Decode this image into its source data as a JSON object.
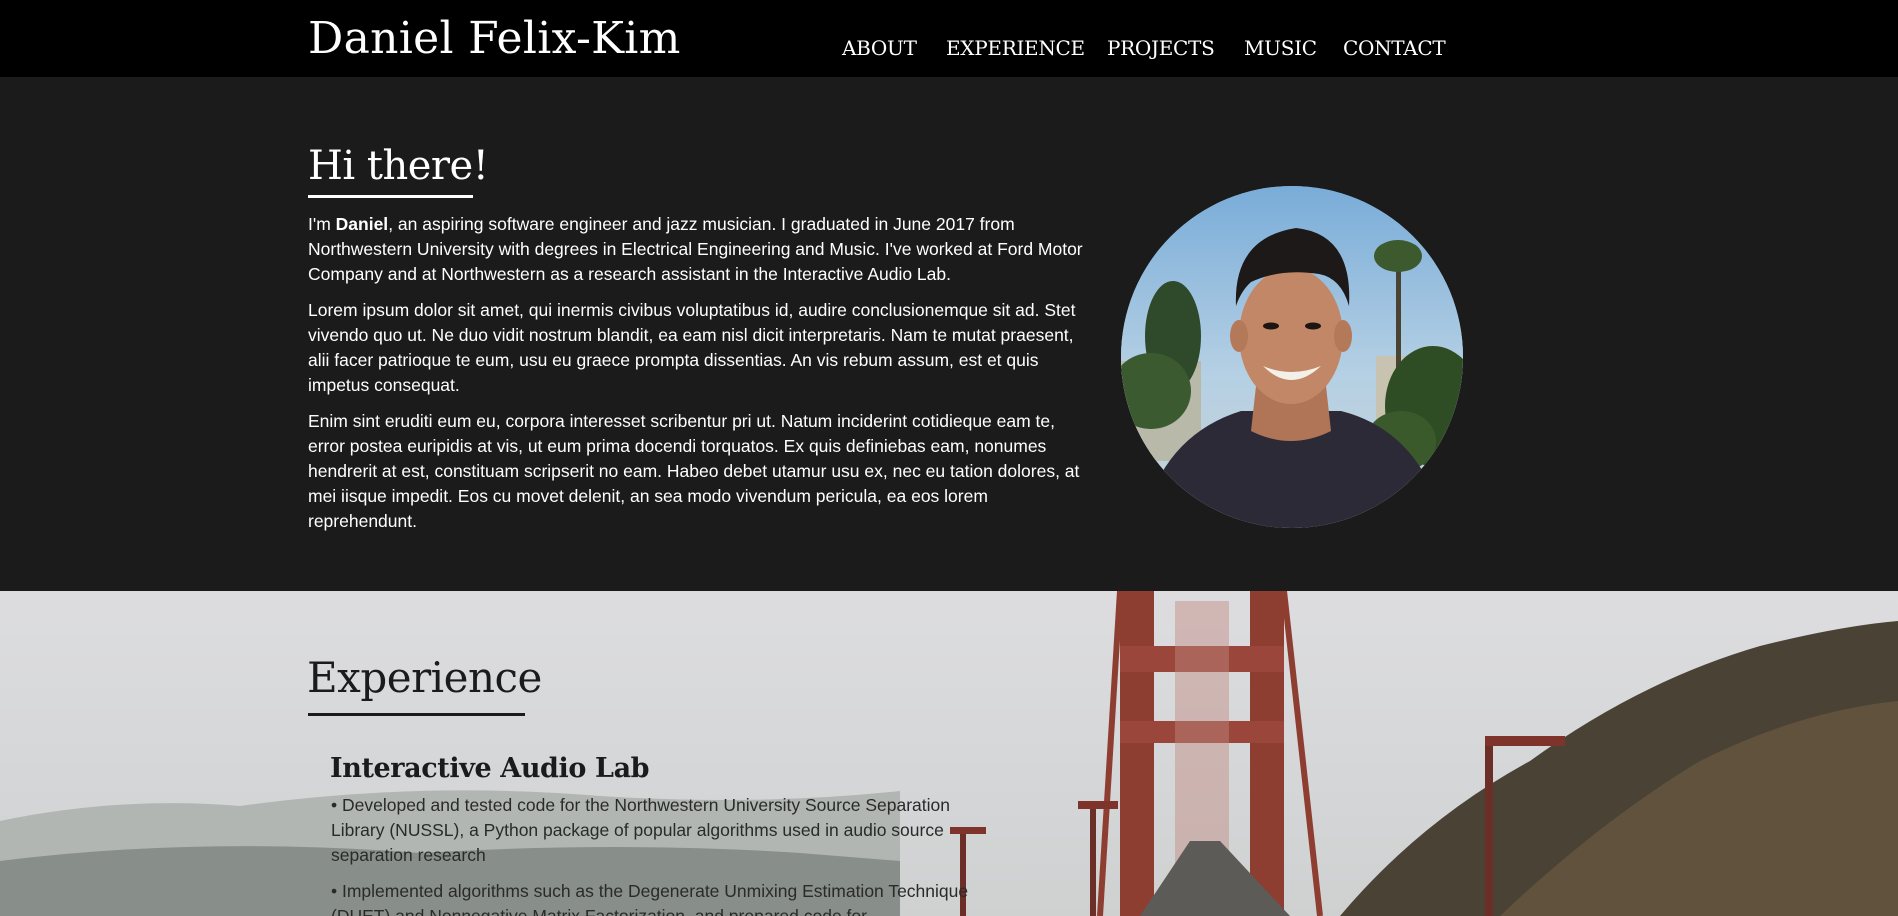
{
  "header": {
    "brand": "Daniel Felix-Kim",
    "nav": {
      "about": "ABOUT",
      "experience": "EXPERIENCE",
      "projects": "PROJECTS",
      "music": "MUSIC",
      "contact": "CONTACT"
    }
  },
  "about": {
    "title": "Hi there!",
    "intro_prefix": "I'm ",
    "intro_name": "Daniel",
    "intro_rest": ", an aspiring software engineer and jazz musician. I graduated in June 2017 from Northwestern University with degrees in Electrical Engineering and Music. I've worked at Ford Motor Company and at Northwestern as a research assistant in the Interactive Audio Lab.",
    "para2": "Lorem ipsum dolor sit amet, qui inermis civibus voluptatibus id, audire conclusionemque sit ad. Stet vivendo quo ut. Ne duo vidit nostrum blandit, ea eam nisl dicit interpretaris. Nam te mutat praesent, alii facer patrioque te eum, usu eu graece prompta dissentias. An vis rebum assum, est et quis impetus consequat.",
    "para3": "Enim sint eruditi eum eu, corpora interesset scribentur pri ut. Natum inciderint cotidieque eam te, error postea euripidis at vis, ut eum prima docendi torquatos. Ex quis definiebas eam, nonumes hendrerit at est, constituam scripserit no eam. Habeo debet utamur usu ex, nec eu tation dolores, at mei iisque impedit. Eos cu movet delenit, an sea modo vivendum pericula, ea eos lorem reprehendunt."
  },
  "experience": {
    "title": "Experience",
    "jobs": [
      {
        "title": "Interactive Audio Lab",
        "bullets": [
          "• Developed and tested code for the Northwestern University Source Separation Library (NUSSL), a Python package of popular algorithms used in audio source separation research",
          "• Implemented algorithms such as the Degenerate Unmixing Estimation Technique (DUET) and Nonnegative Matrix Factorization, and prepared code for"
        ]
      }
    ]
  },
  "colors": {
    "nav_bg": "#000000",
    "about_bg": "#1b1b1b",
    "text_light": "#ffffff",
    "text_dark": "#1b1b1b",
    "bridge": "#9a3c2e"
  }
}
